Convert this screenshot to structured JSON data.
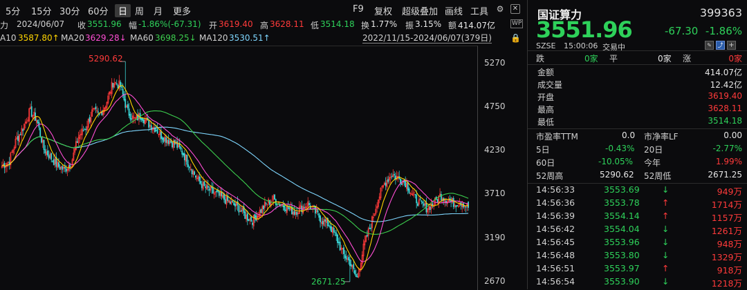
{
  "toolbar": {
    "periods": [
      "5分",
      "15分",
      "30分",
      "60分",
      "日",
      "周",
      "月",
      "更多"
    ],
    "active_period": "日",
    "right_items": [
      "F9",
      "复权",
      "超级叠加",
      "画线",
      "工具"
    ]
  },
  "info": {
    "prefix": "力",
    "date": "2024/06/07",
    "close_label": "收",
    "close": "3551.96",
    "change_label": "幅",
    "change": "-1.86%(-67.31)",
    "open_label": "开",
    "open": "3619.40",
    "high_label": "高",
    "high": "3628.11",
    "low_label": "低",
    "low": "3514.18",
    "turnover_label": "换",
    "turnover": "1.77%",
    "amplitude_label": "振",
    "amplitude": "3.15%",
    "amount_label": "额",
    "amount": "414.07亿",
    "wp": "WP"
  },
  "ma": {
    "ma10_label": "A10",
    "ma10": "3587.80↑",
    "ma20_label": "MA20",
    "ma20": "3629.28↓",
    "ma60_label": "MA60",
    "ma60": "3698.25↓",
    "ma120_label": "MA120",
    "ma120": "3530.51↑",
    "range": "2022/11/15-2024/06/07(379日)"
  },
  "chart": {
    "y_ticks": [
      "5270",
      "4750",
      "4230",
      "3710",
      "3190",
      "2670"
    ],
    "y_tick_values": [
      5270,
      4750,
      4230,
      3710,
      3190,
      2670
    ],
    "max_label": "5290.62",
    "min_label": "2671.25",
    "colors": {
      "up": "#ff3a3a",
      "down": "#3ad6d6",
      "ma10": "#ffd400",
      "ma20": "#ff4ed5",
      "ma60": "#3ccf4e",
      "ma120": "#7fd7ff"
    }
  },
  "chart_data": {
    "type": "candlestick",
    "x_range": [
      "2022/11/15",
      "2024/06/07"
    ],
    "ylim": [
      2670,
      5290.62
    ],
    "y_ticks": [
      5270,
      4750,
      4230,
      3710,
      3190,
      2670
    ],
    "annotations": [
      {
        "text": "5290.62",
        "value": 5290.62,
        "kind": "max"
      },
      {
        "text": "2671.25",
        "value": 2671.25,
        "kind": "min"
      }
    ],
    "close_path_approx": [
      4050,
      4100,
      4350,
      4500,
      4700,
      4600,
      4250,
      4150,
      4050,
      4000,
      4100,
      4400,
      4500,
      4700,
      4650,
      4800,
      5050,
      5000,
      4700,
      4600,
      4650,
      4550,
      4500,
      4400,
      4350,
      4300,
      4200,
      4050,
      3900,
      3800,
      3750,
      3700,
      3650,
      3600,
      3550,
      3450,
      3400,
      3500,
      3600,
      3650,
      3600,
      3550,
      3500,
      3550,
      3600,
      3500,
      3400,
      3350,
      3200,
      3000,
      2900,
      2700,
      3100,
      3350,
      3650,
      3850,
      3950,
      3900,
      3850,
      3700,
      3600,
      3550,
      3600,
      3700,
      3650,
      3600,
      3620,
      3552
    ],
    "series": [
      {
        "name": "MA10",
        "last": 3587.8
      },
      {
        "name": "MA20",
        "last": 3629.28
      },
      {
        "name": "MA60",
        "last": 3698.25
      },
      {
        "name": "MA120",
        "last": 3530.51
      }
    ]
  },
  "quote": {
    "name": "国证算力",
    "code": "399363",
    "price": "3551.96",
    "change": "-67.30",
    "pct": "-1.86%",
    "exchange": "SZSE",
    "time": "15:00:06",
    "status": "交易中",
    "fall_label": "跌",
    "fall_count": "0家",
    "flat_label": "平",
    "flat_count": "0家",
    "rise_label": "涨",
    "rise_count": "0家",
    "stats": [
      {
        "label": "金额",
        "value": "414.07亿",
        "color": "white"
      },
      {
        "label": "成交量",
        "value": "12.42亿",
        "color": "white"
      },
      {
        "label": "开盘",
        "value": "3619.40",
        "color": "red"
      },
      {
        "label": "最高",
        "value": "3628.11",
        "color": "red"
      },
      {
        "label": "最低",
        "value": "3514.18",
        "color": "green"
      }
    ],
    "pe_label": "市盈率TTM",
    "pe": "0.0",
    "pb_label": "市净率LF",
    "pb": "0.00",
    "d5_label": "5日",
    "d5": "-0.43%",
    "d20_label": "20日",
    "d20": "-2.77%",
    "d60_label": "60日",
    "d60": "-10.05%",
    "ytd_label": "今年",
    "ytd": "1.99%",
    "h52_label": "52周高",
    "h52": "5290.62",
    "l52_label": "52周低",
    "l52": "2671.25",
    "ticks": [
      {
        "time": "14:56:33",
        "price": "3553.69",
        "dir": "down",
        "vol": "949万"
      },
      {
        "time": "14:56:36",
        "price": "3553.78",
        "dir": "up",
        "vol": "1714万"
      },
      {
        "time": "14:56:39",
        "price": "3554.14",
        "dir": "up",
        "vol": "1157万"
      },
      {
        "time": "14:56:42",
        "price": "3554.04",
        "dir": "down",
        "vol": "1261万"
      },
      {
        "time": "14:56:45",
        "price": "3553.96",
        "dir": "down",
        "vol": "948万"
      },
      {
        "time": "14:56:48",
        "price": "3553.80",
        "dir": "down",
        "vol": "1329万"
      },
      {
        "time": "14:56:51",
        "price": "3553.97",
        "dir": "up",
        "vol": "918万"
      },
      {
        "time": "14:56:54",
        "price": "3553.90",
        "dir": "down",
        "vol": "1218万"
      }
    ]
  }
}
